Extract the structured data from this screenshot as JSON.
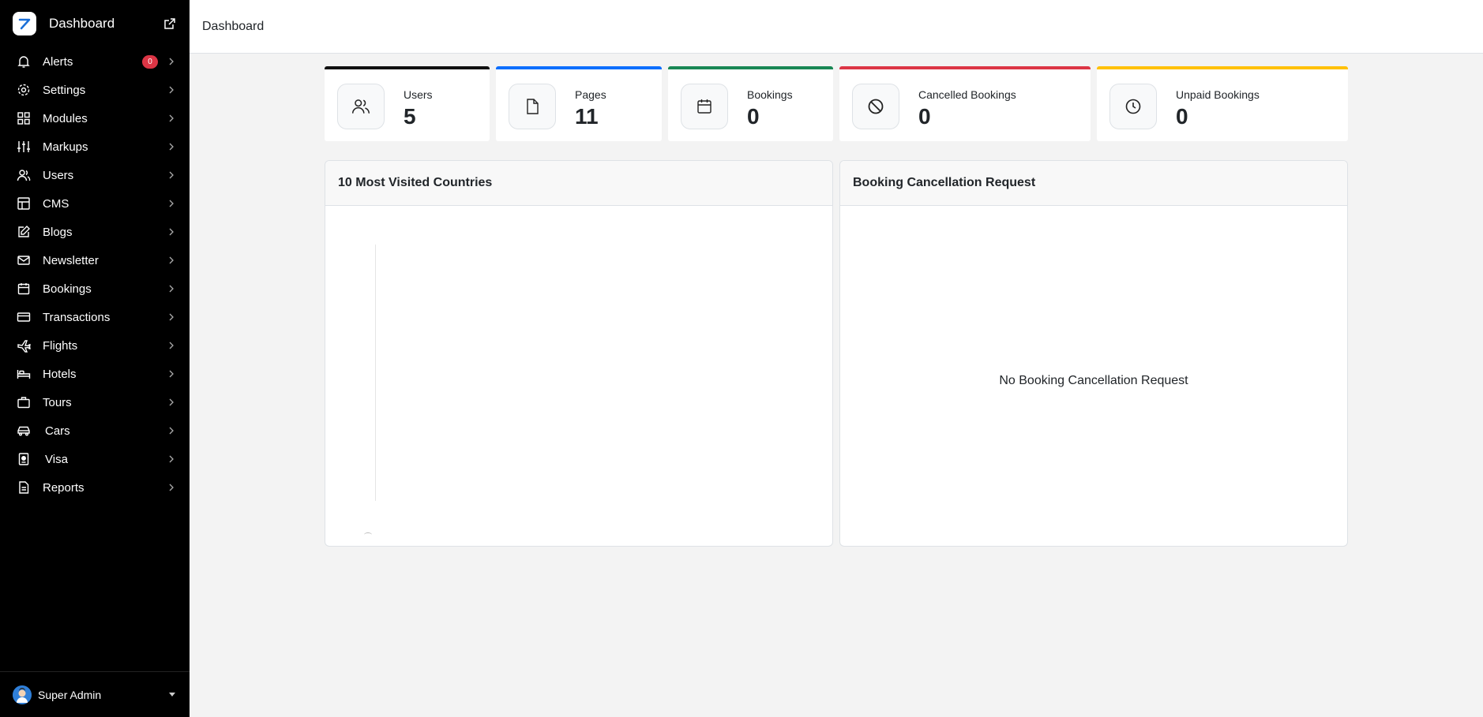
{
  "brand": {
    "title": "Dashboard"
  },
  "sidebar": {
    "items": [
      {
        "label": "Alerts",
        "icon": "bell-icon",
        "badge": "0"
      },
      {
        "label": "Settings",
        "icon": "gear-icon"
      },
      {
        "label": "Modules",
        "icon": "grid-icon"
      },
      {
        "label": "Markups",
        "icon": "sliders-icon"
      },
      {
        "label": "Users",
        "icon": "users-icon"
      },
      {
        "label": "CMS",
        "icon": "layout-icon"
      },
      {
        "label": "Blogs",
        "icon": "edit-icon"
      },
      {
        "label": "Newsletter",
        "icon": "mail-icon"
      },
      {
        "label": "Bookings",
        "icon": "calendar-icon"
      },
      {
        "label": "Transactions",
        "icon": "credit-card-icon"
      },
      {
        "label": "Flights",
        "icon": "plane-icon"
      },
      {
        "label": "Hotels",
        "icon": "bed-icon"
      },
      {
        "label": "Tours",
        "icon": "briefcase-icon"
      },
      {
        "label": "Cars",
        "icon": "car-icon"
      },
      {
        "label": "Visa",
        "icon": "passport-icon"
      },
      {
        "label": "Reports",
        "icon": "file-text-icon"
      }
    ]
  },
  "user": {
    "name": "Super Admin"
  },
  "header": {
    "title": "Dashboard"
  },
  "stats": [
    {
      "label": "Users",
      "value": "5",
      "color": "#111111",
      "icon": "users-icon"
    },
    {
      "label": "Pages",
      "value": "11",
      "color": "#0d6efd",
      "icon": "file-icon"
    },
    {
      "label": "Bookings",
      "value": "0",
      "color": "#198754",
      "icon": "calendar-icon"
    },
    {
      "label": "Cancelled Bookings",
      "value": "0",
      "color": "#dc3545",
      "icon": "ban-icon"
    },
    {
      "label": "Unpaid Bookings",
      "value": "0",
      "color": "#ffc107",
      "icon": "clock-icon"
    }
  ],
  "cards": {
    "countries": {
      "title": "10 Most Visited Countries"
    },
    "cancellation": {
      "title": "Booking Cancellation Request",
      "empty": "No Booking Cancellation Request"
    }
  }
}
